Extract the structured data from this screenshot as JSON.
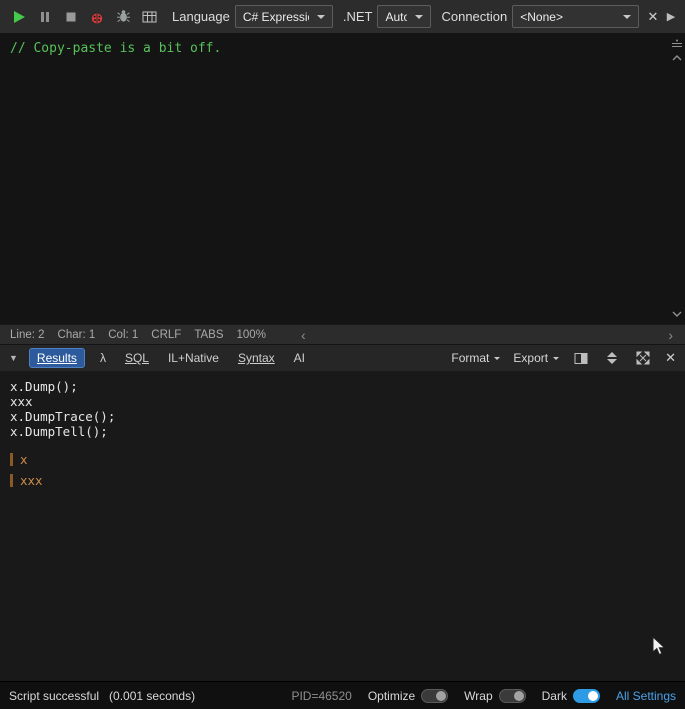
{
  "toolbar": {
    "language_label": "Language",
    "language_value": "C# Expression",
    "dotnet_label": ".NET",
    "dotnet_value": "Auto",
    "connection_label": "Connection",
    "connection_value": "<None>",
    "close_glyph": "✕",
    "more_glyph": "▶"
  },
  "editor": {
    "code_line": "// Copy-paste is a bit off."
  },
  "editor_status": {
    "items": [
      "Line: 2",
      "Char: 1",
      "Col: 1",
      "CRLF",
      "TABS",
      "100%"
    ],
    "scroll_left_glyph": "‹",
    "scroll_right_glyph": "›"
  },
  "results_panel": {
    "collapse_glyph": "▼",
    "tabs": [
      "Results",
      "λ",
      "SQL",
      "IL+Native",
      "Syntax",
      "AI"
    ],
    "format_label": "Format",
    "export_label": "Export",
    "close_glyph": "✕"
  },
  "results": {
    "code_lines": [
      "x.Dump();",
      "xxx",
      "x.DumpTrace();",
      "x.DumpTell();"
    ],
    "dump_items": [
      "x",
      "xxx"
    ]
  },
  "status_bar": {
    "message": "Script successful",
    "duration": "(0.001 seconds)",
    "pid": "PID=46520",
    "optimize_label": "Optimize",
    "optimize_on": false,
    "wrap_label": "Wrap",
    "wrap_on": false,
    "dark_label": "Dark",
    "dark_on": true,
    "all_settings_label": "All Settings"
  },
  "colors": {
    "toolbar_bg": "#2c2c2c",
    "editor_bg": "#141414",
    "results_bg": "#191919",
    "statusbar_bg": "#101010",
    "comment_green": "#57c15a",
    "selected_tab_blue": "#2d5a9c",
    "dump_text_orange": "#cd8d4e",
    "dump_bar_brown": "#8a5a26",
    "toggle_on_blue": "#2e9be6",
    "link_blue": "#4ba0e8",
    "play_green": "#45c94a",
    "ladybug_red": "#d63b3b"
  }
}
